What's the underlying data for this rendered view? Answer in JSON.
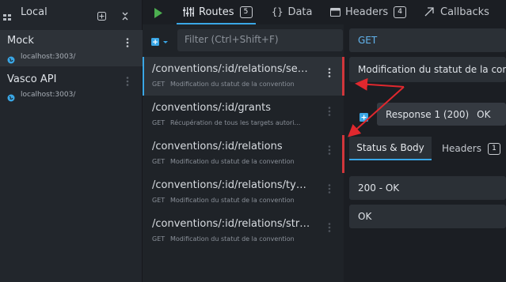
{
  "environments": {
    "title": "Local",
    "items": [
      {
        "name": "Mock",
        "host": "localhost:3003/",
        "active": true
      },
      {
        "name": "Vasco API",
        "host": "localhost:3003/",
        "active": false
      }
    ]
  },
  "tabs": {
    "routes": {
      "label": "Routes",
      "count": "5"
    },
    "data": {
      "label": "Data"
    },
    "headers": {
      "label": "Headers",
      "count": "4"
    },
    "callbacks": {
      "label": "Callbacks"
    }
  },
  "routes_panel": {
    "filter_placeholder": "Filter (Ctrl+Shift+F)",
    "routes": [
      {
        "path": "/conventions/:id/relations/search…",
        "method": "GET",
        "doc": "Modification du statut de la convention",
        "active": true
      },
      {
        "path": "/conventions/:id/grants",
        "method": "GET",
        "doc": "Récupération de tous les targets autori…",
        "active": false
      },
      {
        "path": "/conventions/:id/relations",
        "method": "GET",
        "doc": "Modification du statut de la convention",
        "active": false
      },
      {
        "path": "/conventions/:id/relations/types-…",
        "method": "GET",
        "doc": "Modification du statut de la convention",
        "active": false
      },
      {
        "path": "/conventions/:id/relations/struct…",
        "method": "GET",
        "doc": "Modification du statut de la convention",
        "active": false
      }
    ]
  },
  "detail": {
    "method": "GET",
    "documentation": "Modification du statut de la convention",
    "response_label": "Response 1 (200)",
    "response_status_text": "OK",
    "subtabs": {
      "status_body": "Status & Body",
      "headers": "Headers",
      "headers_count": "1"
    },
    "status_code": "200 - OK",
    "status_message": "OK"
  },
  "colors": {
    "accent": "#3aa7e6",
    "play": "#4caf50",
    "annotation_red": "#d1363b"
  }
}
